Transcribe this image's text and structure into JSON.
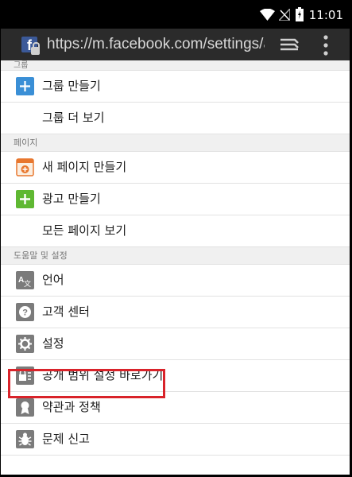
{
  "status_bar": {
    "time": "11:01"
  },
  "browser": {
    "url": "https://m.facebook.com/settings/ap"
  },
  "sections": [
    {
      "header": "그룹",
      "items": [
        {
          "label": "그룹 만들기",
          "icon": "plus-icon"
        },
        {
          "label": "그룹 더 보기",
          "icon": ""
        }
      ]
    },
    {
      "header": "페이지",
      "items": [
        {
          "label": "새 페이지 만들기",
          "icon": "new-page-icon"
        },
        {
          "label": "광고 만들기",
          "icon": "create-ad-icon"
        },
        {
          "label": "모든 페이지 보기",
          "icon": ""
        }
      ]
    },
    {
      "header": "도움말 및 설정",
      "items": [
        {
          "label": "언어",
          "icon": "language-icon"
        },
        {
          "label": "고객 센터",
          "icon": "help-icon"
        },
        {
          "label": "설정",
          "icon": "gear-icon"
        },
        {
          "label": "공개 범위 설정 바로가기",
          "icon": "privacy-shortcut-icon"
        },
        {
          "label": "약관과 정책",
          "icon": "terms-icon"
        },
        {
          "label": "문제 신고",
          "icon": "report-bug-icon"
        }
      ]
    }
  ],
  "colors": {
    "highlight": "#d9232a",
    "facebook_blue": "#3b5998",
    "plus_blue": "#3a8fd6",
    "ad_green": "#5fb832",
    "page_orange": "#e8772e",
    "icon_gray": "#7b7b7b"
  }
}
